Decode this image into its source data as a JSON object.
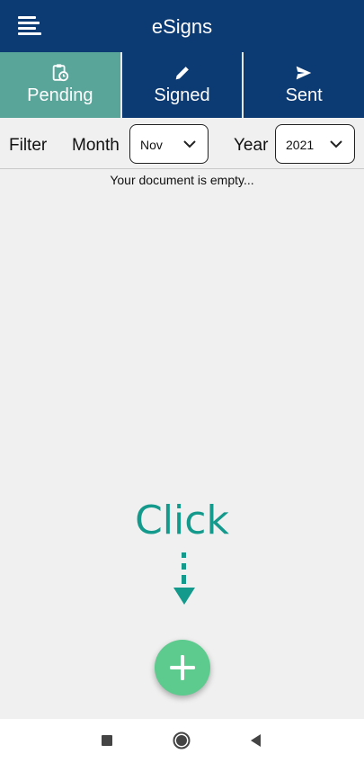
{
  "appbar": {
    "title": "eSigns",
    "menu_icon": "menu-icon"
  },
  "tabs": [
    {
      "label": "Pending",
      "icon": "clipboard-clock-icon",
      "active": true
    },
    {
      "label": "Signed",
      "icon": "pencil-icon",
      "active": false
    },
    {
      "label": "Sent",
      "icon": "send-icon",
      "active": false
    }
  ],
  "filter": {
    "label": "Filter",
    "month_label": "Month",
    "month_value": "Nov",
    "year_label": "Year",
    "year_value": "2021"
  },
  "content": {
    "empty_message": "Your document is empty..."
  },
  "hint": {
    "text": "Click",
    "arrow_icon": "dashed-arrow-down-icon"
  },
  "fab": {
    "icon": "plus-icon"
  },
  "colors": {
    "primary": "#0c3a73",
    "tab_active": "#5aa59a",
    "accent": "#149a8c",
    "fab": "#5ccb8d",
    "background": "#f0f0f0"
  },
  "navbar": {
    "recents_icon": "square-icon",
    "home_icon": "circle-icon",
    "back_icon": "triangle-back-icon"
  }
}
